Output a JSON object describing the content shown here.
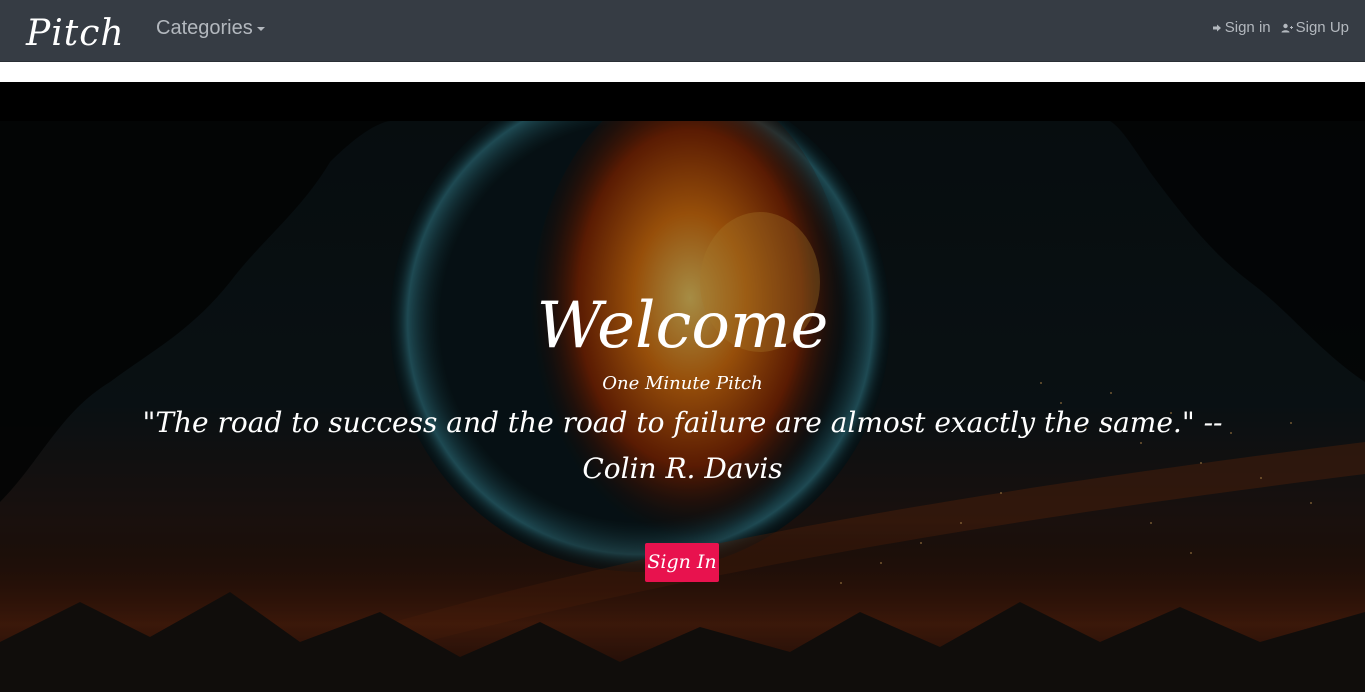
{
  "navbar": {
    "brand": "Pitch",
    "categories_label": "Categories",
    "sign_in_label": "Sign in",
    "sign_up_label": "Sign Up",
    "icons": {
      "sign_in": "sign-in-arrow-icon",
      "sign_up": "user-plus-icon",
      "categories": "caret-down-icon"
    }
  },
  "hero": {
    "title": "Welcome",
    "subtitle": "One Minute Pitch",
    "quote": "\"The road to success and the road to failure are almost exactly the same.\" -- Colin R. Davis",
    "button_label": "Sign In"
  },
  "colors": {
    "navbar_bg": "#363c44",
    "nav_text": "#b3b8be",
    "button_bg": "#e8124e",
    "hero_text": "#ffffff"
  }
}
